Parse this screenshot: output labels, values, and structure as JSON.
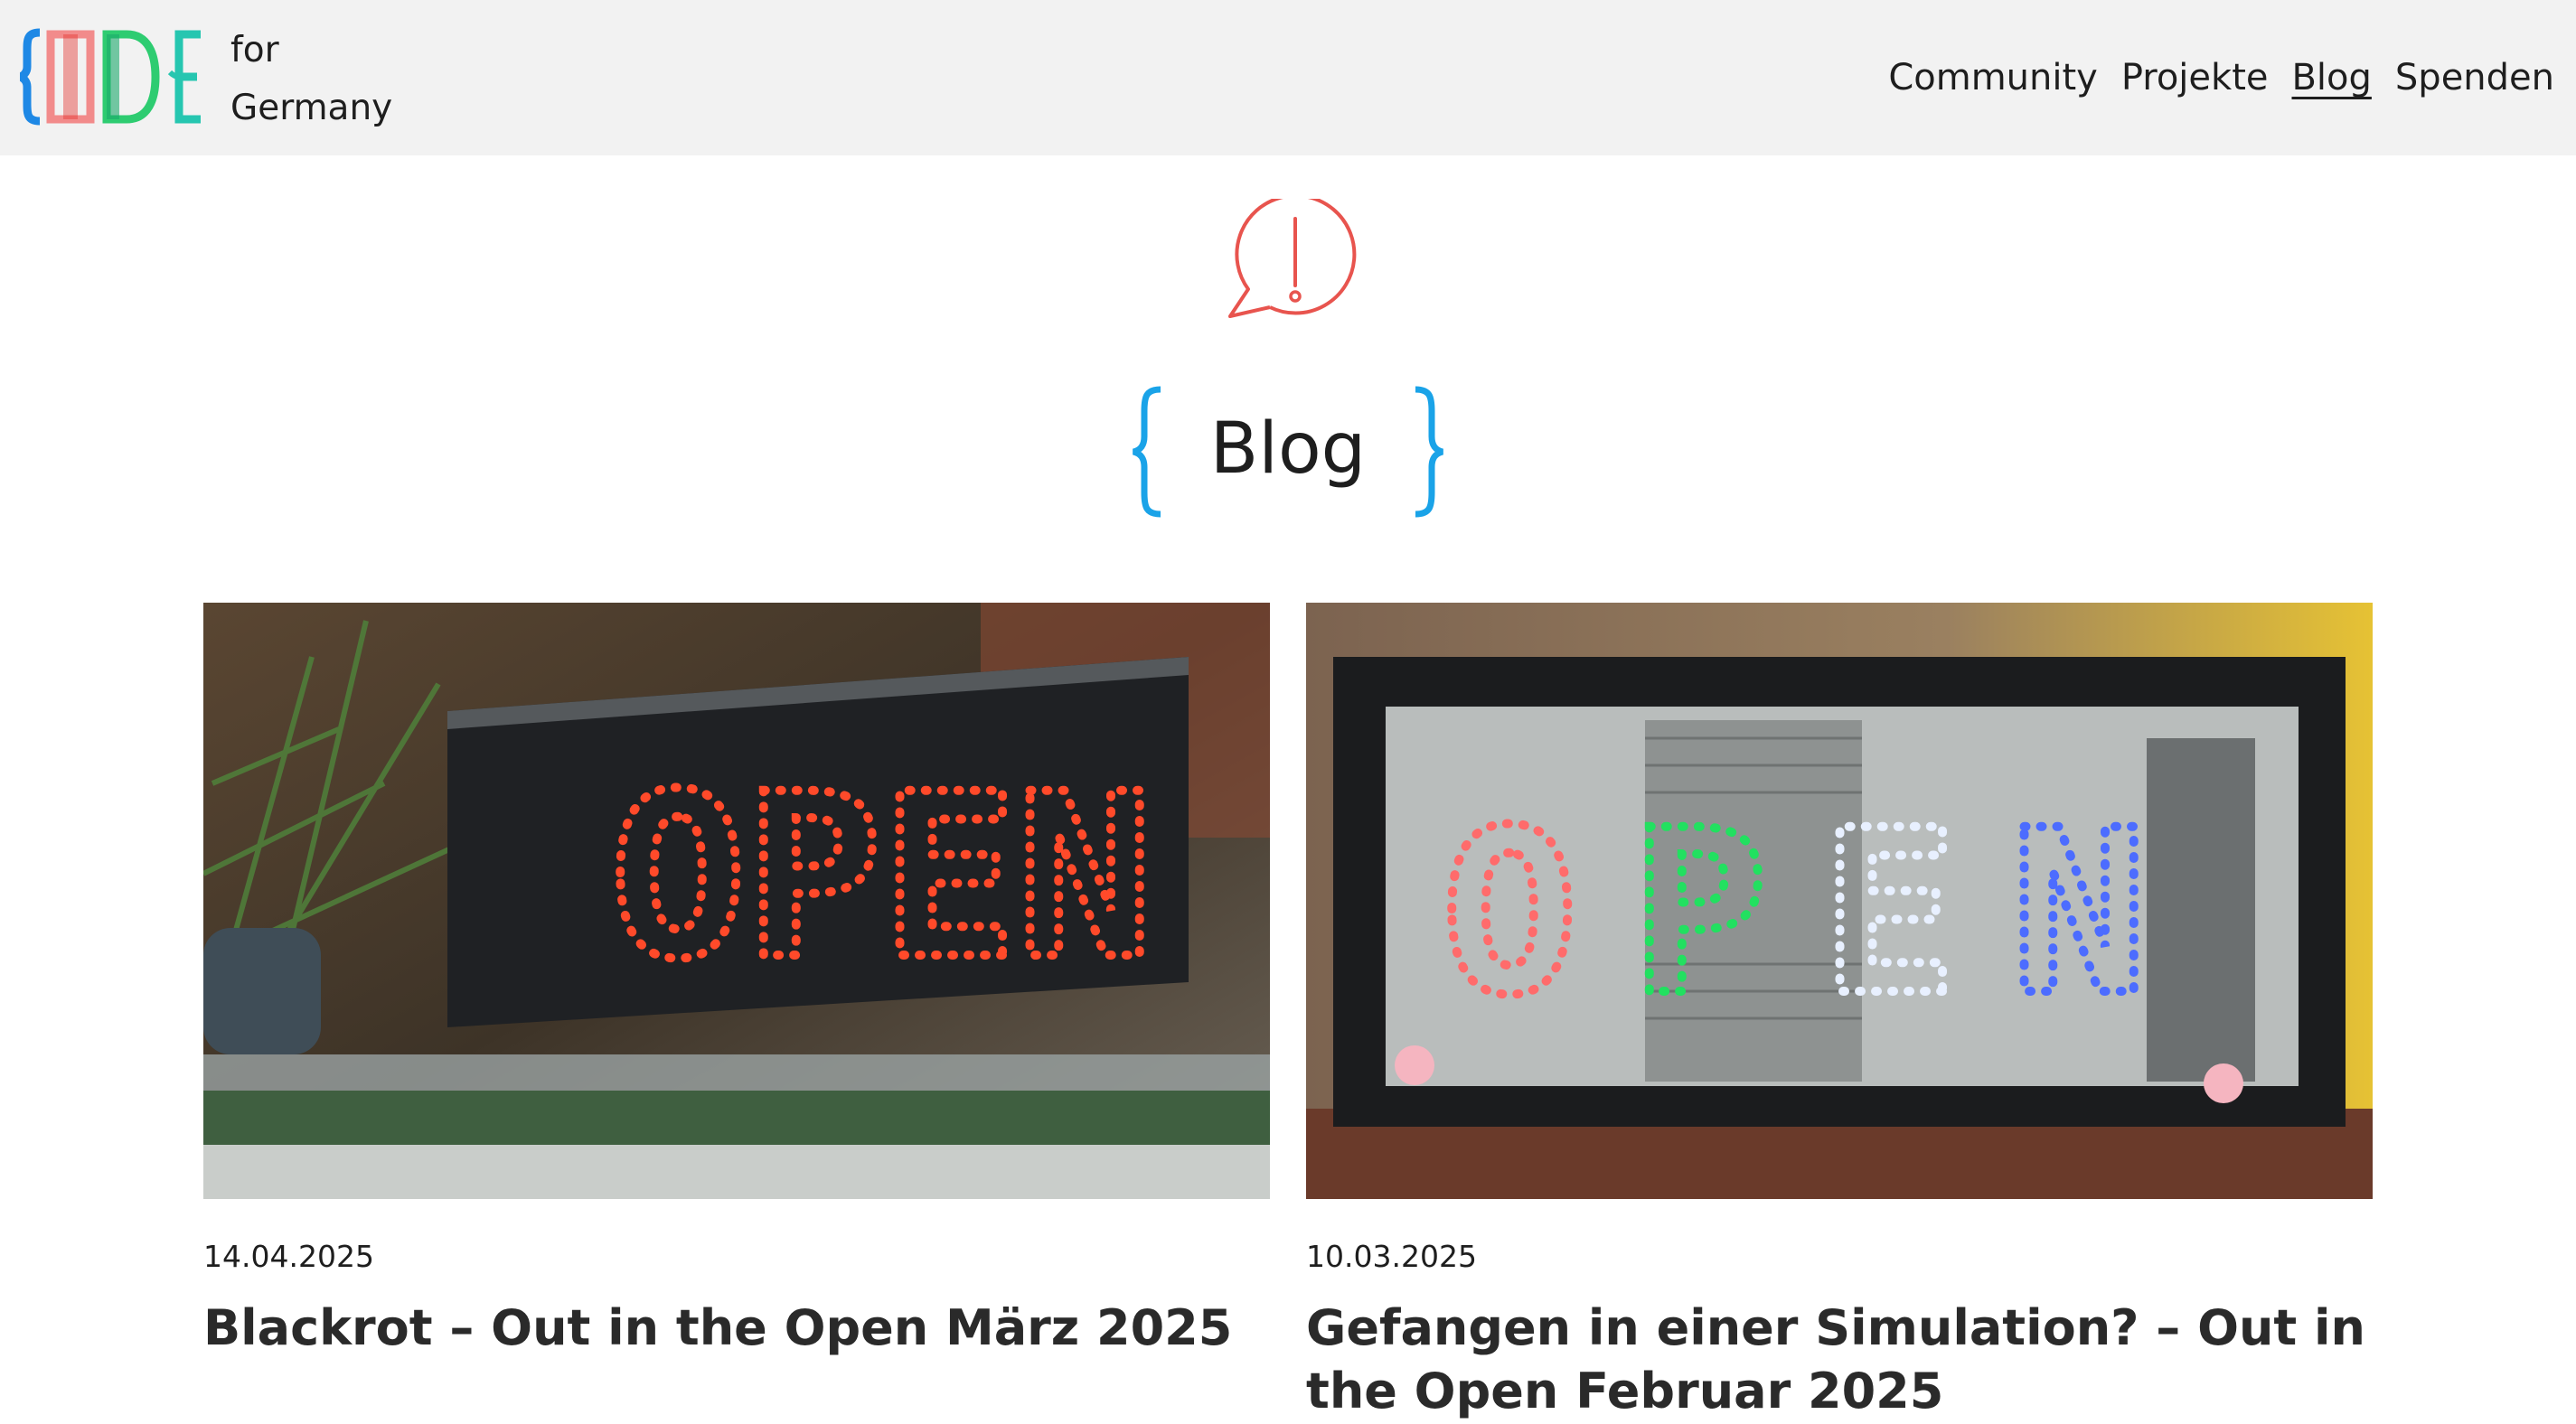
{
  "header": {
    "brand_line1": "for",
    "brand_line2": "Germany",
    "nav": [
      {
        "label": "Community"
      },
      {
        "label": "Projekte"
      },
      {
        "label": "Blog"
      },
      {
        "label": "Spenden"
      }
    ],
    "active_nav": "Blog"
  },
  "page": {
    "title": "Blog"
  },
  "posts": [
    {
      "date": "14.04.2025",
      "title": "Blackrot – Out in the Open März 2025",
      "image_sign_text": "OPEN"
    },
    {
      "date": "10.03.2025",
      "title": "Gefangen in einer Simulation? – Out in the Open Februar 2025",
      "image_sign_text": "OPEN"
    }
  ],
  "colors": {
    "header_bg": "#f2f2f2",
    "brace_blue": "#1aa3e8",
    "alert_red": "#e8544e",
    "logo_blue": "#1e88e5",
    "logo_red": "#e53935",
    "logo_green": "#2ecc71",
    "logo_teal": "#26c6b0"
  }
}
